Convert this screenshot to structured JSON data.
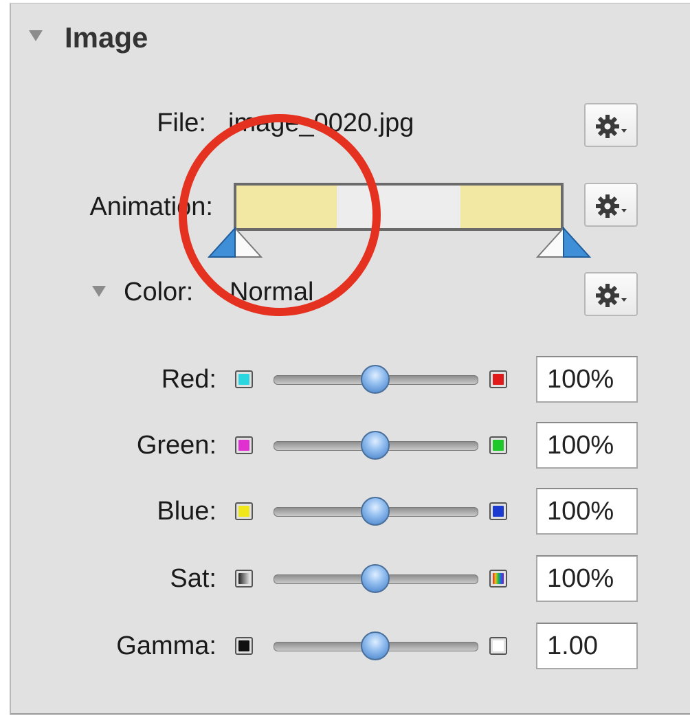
{
  "section": {
    "title": "Image"
  },
  "file": {
    "label": "File:",
    "value": "image_0020.jpg"
  },
  "animation": {
    "label": "Animation:"
  },
  "color": {
    "label": "Color:",
    "value": "Normal"
  },
  "sliders": [
    {
      "label": "Red:",
      "value": "100%",
      "level": 0.5,
      "left_color": "#2ad6e0",
      "right_color": "#e01a1a"
    },
    {
      "label": "Green:",
      "value": "100%",
      "level": 0.5,
      "left_color": "#e030d0",
      "right_color": "#1ec82a"
    },
    {
      "label": "Blue:",
      "value": "100%",
      "level": 0.5,
      "left_color": "#f0e81a",
      "right_color": "#1a3ad0"
    },
    {
      "label": "Sat:",
      "value": "100%",
      "level": 0.5,
      "left_color": "grayscale-gradient",
      "right_color": "rainbow-gradient"
    },
    {
      "label": "Gamma:",
      "value": "1.00",
      "level": 0.5,
      "left_color": "#111111",
      "right_color": "#ffffff"
    }
  ],
  "icons": {
    "disclosure": "triangle-down-icon",
    "action": "gear-icon",
    "keyframe": "keyframe-marker-icon"
  },
  "colors": {
    "panel": "#e1e1e1",
    "highlight_circle": "#e5311f",
    "animation_active": "#f3e7a4",
    "animation_inactive": "#ededed",
    "knob": "#5a92d8"
  }
}
